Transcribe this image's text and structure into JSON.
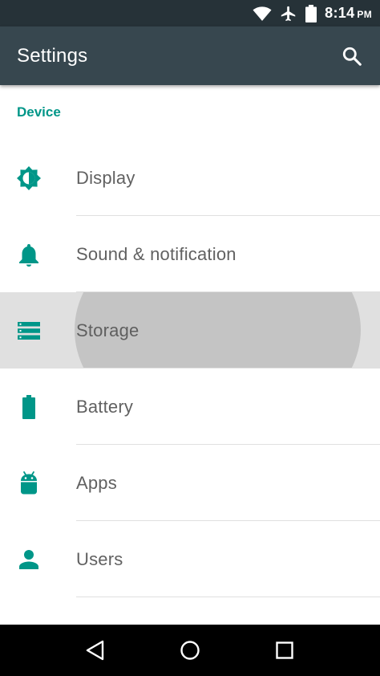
{
  "status_bar": {
    "time": "8:14",
    "ampm": "PM",
    "icons": [
      "wifi-icon",
      "airplane-mode-icon",
      "battery-icon"
    ]
  },
  "app_bar": {
    "title": "Settings",
    "search_icon": "search-icon"
  },
  "section": {
    "header": "Device"
  },
  "items": [
    {
      "label": "Display",
      "icon": "brightness-icon"
    },
    {
      "label": "Sound & notification",
      "icon": "bell-icon"
    },
    {
      "label": "Storage",
      "icon": "storage-icon",
      "pressed": true
    },
    {
      "label": "Battery",
      "icon": "battery-icon"
    },
    {
      "label": "Apps",
      "icon": "android-icon"
    },
    {
      "label": "Users",
      "icon": "person-icon"
    }
  ],
  "nav_bar": {
    "icons": [
      "back-icon",
      "home-icon",
      "recents-icon"
    ]
  },
  "colors": {
    "accent": "#009688",
    "app_bar": "#37474f",
    "status_bar": "#263238",
    "text_secondary": "#616161",
    "divider": "#e0e0e0",
    "pressed": "#e0e0e0",
    "ripple": "#c4c4c4"
  }
}
